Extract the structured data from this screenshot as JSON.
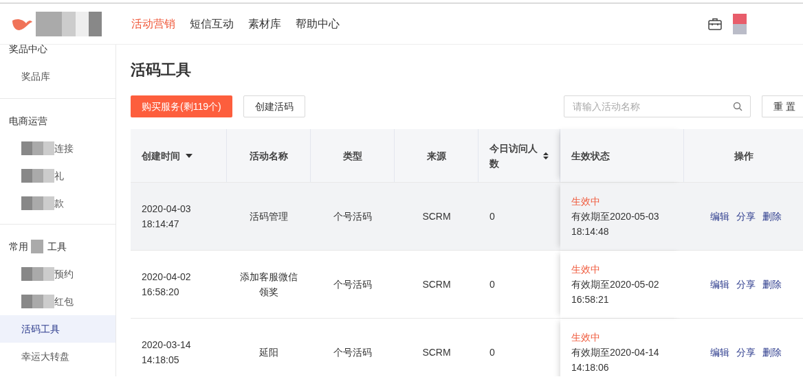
{
  "top_nav": {
    "items": [
      {
        "label": "活动营销",
        "selected": true
      },
      {
        "label": "短信互动",
        "selected": false
      },
      {
        "label": "素材库",
        "selected": false
      },
      {
        "label": "帮助中心",
        "selected": false
      }
    ]
  },
  "sidebar": {
    "groups": [
      {
        "title": "奖品中心",
        "items": [
          {
            "label": "奖品库",
            "selected": false
          }
        ]
      },
      {
        "title": "电商运营",
        "items": [
          {
            "label": "连接",
            "selected": false,
            "redacted": true
          },
          {
            "label": "礼",
            "selected": false,
            "redacted": true
          },
          {
            "label": "款",
            "selected": false,
            "redacted": true
          }
        ]
      },
      {
        "title": "常用",
        "title_tail": "工具",
        "items": [
          {
            "label": "预约",
            "selected": false,
            "redacted": true
          },
          {
            "label": "红包",
            "selected": false,
            "redacted": true
          },
          {
            "label": "活码工具",
            "selected": true
          },
          {
            "label": "幸运大转盘",
            "selected": false
          }
        ]
      }
    ]
  },
  "page": {
    "title": "活码工具"
  },
  "toolbar": {
    "buy_button": "购买服务(剩119个)",
    "create_button": "创建活码",
    "search": {
      "placeholder": "请输入活动名称"
    },
    "reset_button": "重 置"
  },
  "table": {
    "columns": [
      {
        "label": "创建时间",
        "kind": "sortdown"
      },
      {
        "label": "活动名称",
        "kind": "plain"
      },
      {
        "label": "类型",
        "kind": "plain"
      },
      {
        "label": "来源",
        "kind": "plain"
      },
      {
        "label": "今日访问人数",
        "kind": "sortboth"
      },
      {
        "label": "生效状态",
        "kind": "plain"
      },
      {
        "label": "操作",
        "kind": "plain"
      }
    ],
    "rows": [
      {
        "hovered": true,
        "created": [
          "2020-04-03",
          "18:14:47"
        ],
        "name": "活码管理",
        "type": "个号活码",
        "source": "SCRM",
        "visits": "0",
        "status": "生效中",
        "validity": [
          "有效期至2020-05-03",
          "18:14:48"
        ],
        "actions": [
          "编辑",
          "分享",
          "删除"
        ]
      },
      {
        "hovered": false,
        "created": [
          "2020-04-02",
          "16:58:20"
        ],
        "name": "添加客服微信领奖",
        "type": "个号活码",
        "source": "SCRM",
        "visits": "0",
        "status": "生效中",
        "validity": [
          "有效期至2020-05-02",
          "16:58:21"
        ],
        "actions": [
          "编辑",
          "分享",
          "删除"
        ]
      },
      {
        "hovered": false,
        "created": [
          "2020-03-14",
          "14:18:05"
        ],
        "name": "延阳",
        "type": "个号活码",
        "source": "SCRM",
        "visits": "0",
        "status": "生效中",
        "validity": [
          "有效期至2020-04-14",
          "14:18:06"
        ],
        "actions": [
          "编辑",
          "分享",
          "删除"
        ]
      }
    ]
  }
}
